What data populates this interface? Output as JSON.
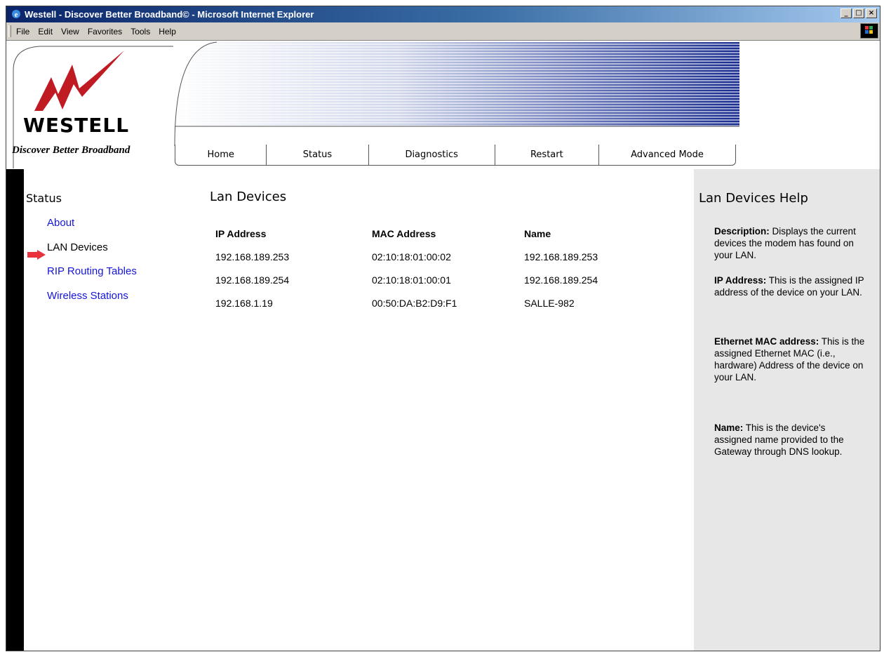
{
  "window": {
    "title": "Westell - Discover Better Broadband© - Microsoft Internet Explorer",
    "buttons": [
      "minimize",
      "maximize",
      "close"
    ]
  },
  "menubar": {
    "items": [
      "File",
      "Edit",
      "View",
      "Favorites",
      "Tools",
      "Help"
    ]
  },
  "header": {
    "brand": "WESTELL",
    "tagline": "Discover Better Broadband",
    "nav": [
      "Home",
      "Status",
      "Diagnostics",
      "Restart",
      "Advanced Mode"
    ]
  },
  "sidebar": {
    "heading": "Status",
    "items": [
      {
        "label": "About",
        "current": false
      },
      {
        "label": "LAN Devices",
        "current": true
      },
      {
        "label": "RIP Routing Tables",
        "current": false
      },
      {
        "label": "Wireless Stations",
        "current": false
      }
    ]
  },
  "main": {
    "title": "Lan Devices",
    "table": {
      "headers": [
        "IP Address",
        "MAC Address",
        "Name"
      ],
      "rows": [
        [
          "192.168.189.253",
          "02:10:18:01:00:02",
          "192.168.189.253"
        ],
        [
          "192.168.189.254",
          "02:10:18:01:00:01",
          "192.168.189.254"
        ],
        [
          "192.168.1.19",
          "00:50:DA:B2:D9:F1",
          "SALLE-982"
        ]
      ]
    }
  },
  "help": {
    "title": "Lan Devices Help",
    "sections": [
      {
        "label": "Description:",
        "text": " Displays the current devices the modem has found on your LAN."
      },
      {
        "label": "IP Address:",
        "text": " This is the assigned IP address of the device on your LAN."
      },
      {
        "label": "Ethernet MAC address:",
        "text": " This is the assigned Ethernet MAC (i.e., hardware) Address of the device on your LAN."
      },
      {
        "label": "Name:",
        "text": " This is the device's assigned name provided to the Gateway through DNS lookup."
      }
    ]
  },
  "colors": {
    "link": "#1515d8",
    "arrow": "#e8323c",
    "help_bg": "#e7e7e7",
    "titlebar": "#0a246a"
  }
}
